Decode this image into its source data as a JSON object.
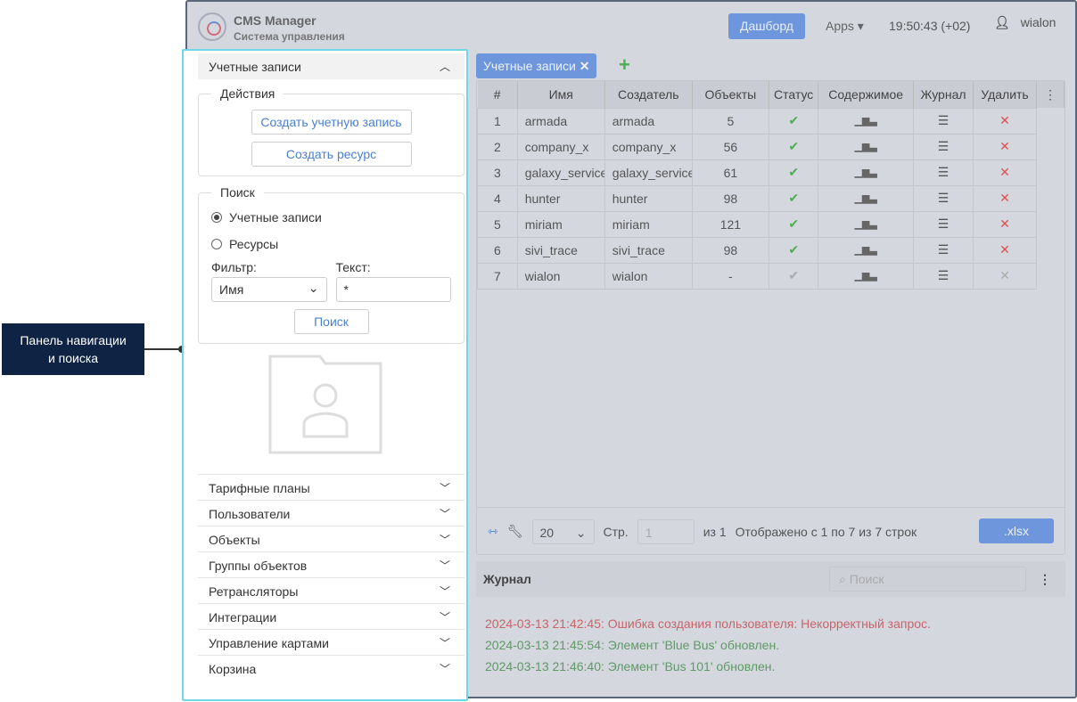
{
  "header": {
    "app_title": "CMS Manager",
    "app_subtitle": "Система управления",
    "dashboard": "Дашборд",
    "apps": "Apps ▾",
    "time": "19:50:43 (+02)",
    "user": "wialon"
  },
  "panel": {
    "section": "Учетные записи",
    "actions_legend": "Действия",
    "create_account": "Создать учетную запись",
    "create_resource": "Создать ресурс",
    "search_legend": "Поиск",
    "radio_accounts": "Учетные записи",
    "radio_resources": "Ресурсы",
    "filter_label": "Фильтр:",
    "filter_value": "Имя",
    "text_label": "Текст:",
    "text_value": "*",
    "search_button": "Поиск",
    "collapsed": [
      "Тарифные планы",
      "Пользователи",
      "Объекты",
      "Группы объектов",
      "Ретрансляторы",
      "Интеграции",
      "Управление картами",
      "Корзина"
    ]
  },
  "tab": {
    "label": "Учетные записи"
  },
  "table": {
    "headers": [
      "#",
      "Имя",
      "Создатель",
      "Объекты",
      "Статус",
      "Содержимое",
      "Журнал",
      "Удалить"
    ],
    "rows": [
      [
        "1",
        "armada",
        "armada",
        "5"
      ],
      [
        "2",
        "company_x",
        "company_x",
        "56"
      ],
      [
        "3",
        "galaxy_service",
        "galaxy_service",
        "61"
      ],
      [
        "4",
        "hunter",
        "hunter",
        "98"
      ],
      [
        "5",
        "miriam",
        "miriam",
        "121"
      ],
      [
        "6",
        "sivi_trace",
        "sivi_trace",
        "98"
      ],
      [
        "7",
        "wialon",
        "wialon",
        "-"
      ]
    ]
  },
  "footer": {
    "page_size": "20",
    "page_label": "Стр.",
    "page": "1",
    "of": "из 1",
    "shown": "Отображено с 1 по 7 из 7 строк",
    "xlsx": ".xlsx"
  },
  "journal": {
    "title": "Журнал",
    "search_placeholder": "Поиск",
    "entries": [
      {
        "text": "2024-03-13 21:42:45: Ошибка создания пользователя: Некорректный запрос.",
        "color": "#c9646a"
      },
      {
        "text": "2024-03-13 21:45:54: Элемент 'Blue Bus' обновлен.",
        "color": "#5f9a66"
      },
      {
        "text": "2024-03-13 21:46:40: Элемент 'Bus 101' обновлен.",
        "color": "#5f9a66"
      }
    ]
  },
  "callout": {
    "line1": "Панель навигации",
    "line2": "и поиска"
  }
}
